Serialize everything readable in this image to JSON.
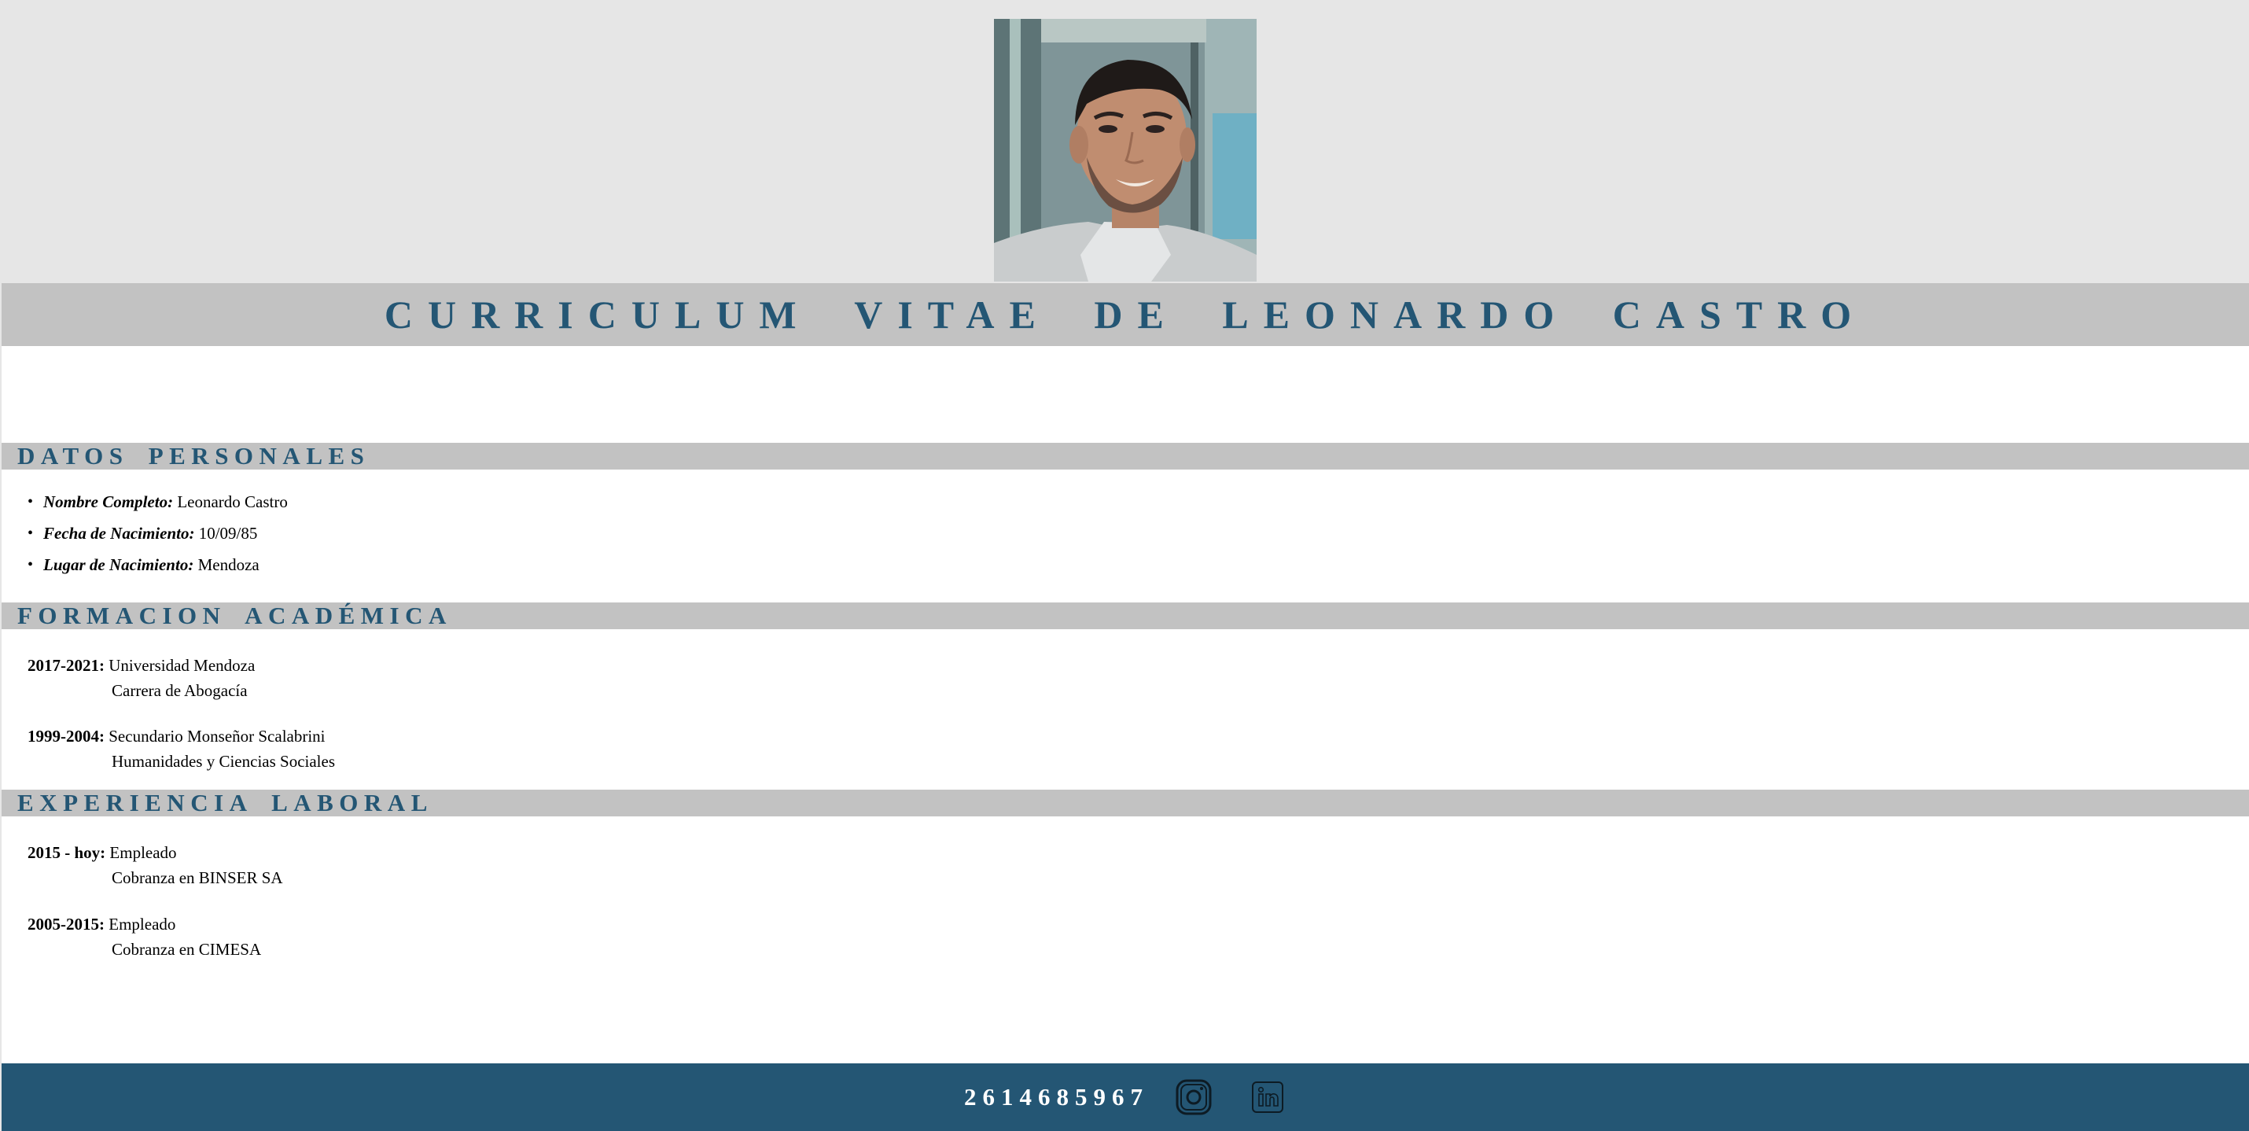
{
  "header": {
    "title": "CURRICULUM VITAE DE LEONARDO CASTRO",
    "photo_alt": "Leonardo Castro"
  },
  "sections": {
    "personal": {
      "heading": "DATOS PERSONALES",
      "items": [
        {
          "label": "Nombre Completo:",
          "value": "Leonardo Castro"
        },
        {
          "label": "Fecha de Nacimiento:",
          "value": "10/09/85"
        },
        {
          "label": "Lugar de Nacimiento:",
          "value": "Mendoza"
        }
      ]
    },
    "education": {
      "heading": "FORMACION ACADÉMICA",
      "entries": [
        {
          "period": "2017-2021:",
          "line1": "Universidad Mendoza",
          "line2": "Carrera de Abogacía"
        },
        {
          "period": "1999-2004:",
          "line1": "Secundario Monseñor Scalabrini",
          "line2": "Humanidades y Ciencias Sociales"
        }
      ]
    },
    "experience": {
      "heading": "EXPERIENCIA LABORAL",
      "entries": [
        {
          "period": "2015 - hoy:",
          "line1": "Empleado",
          "line2": "Cobranza en BINSER SA"
        },
        {
          "period": "2005-2015:",
          "line1": "Empleado",
          "line2": "Cobranza en CIMESA"
        }
      ]
    }
  },
  "footer": {
    "phone": "2614685967",
    "icons": [
      "instagram-icon",
      "linkedin-icon"
    ]
  },
  "colors": {
    "accent": "#245674",
    "band_light": "#e6e6e6",
    "band_mid": "#c2c2c2"
  }
}
